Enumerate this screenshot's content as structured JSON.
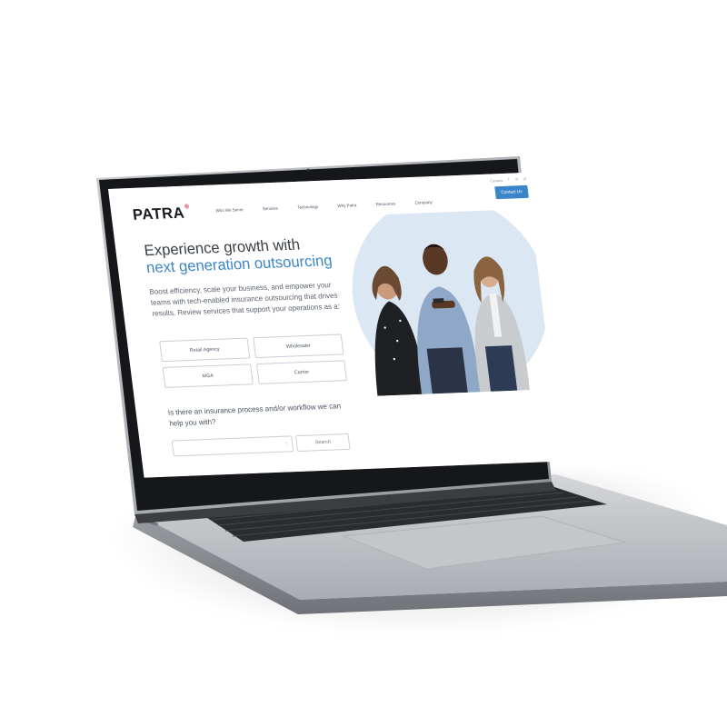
{
  "site": {
    "logo": "PATRA",
    "logo_mark": "®",
    "topbar": {
      "link": "Careers",
      "social": [
        "f",
        "in",
        "yt"
      ]
    },
    "nav": [
      "Who We Serve",
      "Services",
      "Technology",
      "Why Patra",
      "Resources",
      "Company"
    ],
    "contact_label": "Contact Us"
  },
  "hero": {
    "title_line1": "Experience growth with",
    "title_line2": "next generation outsourcing",
    "description": "Boost efficiency, scale your business, and empower your teams with tech-enabled insurance outsourcing that drives results. Review services that support your operations as a:",
    "services": [
      "Retail Agency",
      "Wholesaler",
      "MGA",
      "Carrier"
    ],
    "help_question": "Is there an insurance process and/or workflow we can help you with?",
    "help_placeholder": "",
    "search_label": "Search"
  },
  "colors": {
    "accent": "#3b86c8",
    "heading": "#3a3f46",
    "logo_mark": "#c8102e",
    "laptop_silver": "#b9bcc1",
    "bezel": "#16171a"
  }
}
